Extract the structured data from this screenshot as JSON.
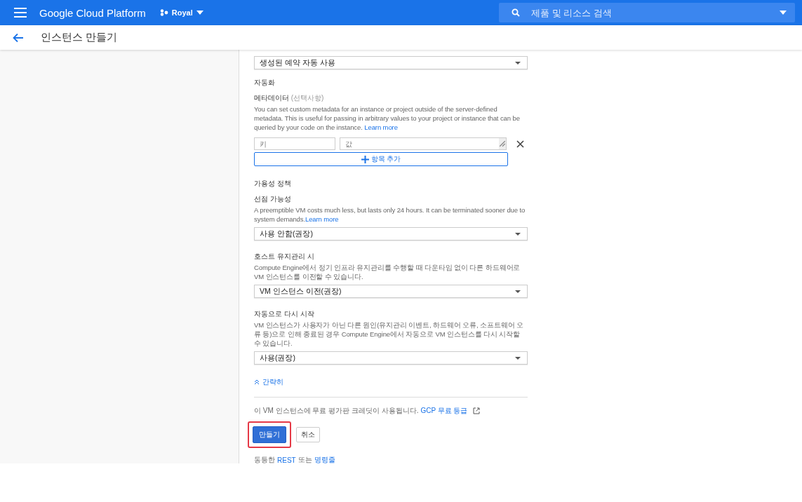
{
  "topbar": {
    "brand": "Google Cloud Platform",
    "project": "Royal",
    "search": {
      "placeholder": "제품 및 리소스 검색"
    }
  },
  "page_title": "인스턴스 만들기",
  "reservation": {
    "value": "생성된 예약 자동 사용"
  },
  "automation": {
    "heading": "자동화",
    "label": "메타데이터",
    "optional": "(선택사항)",
    "description": "You can set custom metadata for an instance or project outside of the server-defined metadata. This is useful for passing in arbitrary values to your project or instance that can be queried by your code on the instance.",
    "link": "Learn more",
    "key_placeholder": "키",
    "value_placeholder": "값",
    "add_button": "항목 추가"
  },
  "availability": {
    "heading": "가용성 정책",
    "fields": [
      {
        "label": "선점 가능성",
        "description": "A preemptible VM costs much less, but lasts only 24 hours. It can be terminated sooner due to system demands.",
        "link": "Learn more",
        "value": "사용 안함(권장)"
      },
      {
        "label": "호스트 유지관리 시",
        "description": "Compute Engine에서 정기 인프라 유지관리를 수행할 때 다운타임 없이 다른 하드웨어로 VM 인스턴스를 이전할 수 있습니다.",
        "value": "VM 인스턴스 이전(권장)"
      },
      {
        "label": "자동으로 다시 시작",
        "description": "VM 인스턴스가 사용자가 아닌 다른 원인(유지관리 이벤트, 하드웨어 오류, 소프트웨어 오류 등)으로 인해 종료된 경우 Compute Engine에서 자동으로 VM 인스턴스를 다시 시작할 수 있습니다.",
        "value": "사용(권장)"
      }
    ]
  },
  "collapse_link": "간략히",
  "free_trial": {
    "text": "이 VM 인스턴스에 무료 평가판 크레딧이 사용됩니다.",
    "link": "GCP 무료 등급"
  },
  "buttons": [
    {
      "label": "만들기",
      "kind": "primary",
      "highlighted": true
    },
    {
      "label": "취소",
      "kind": "secondary",
      "highlighted": false
    }
  ],
  "equivalent": {
    "prefix": "동등한",
    "rest_link": "REST",
    "middle": "또는",
    "cli_link": "명령줄"
  }
}
